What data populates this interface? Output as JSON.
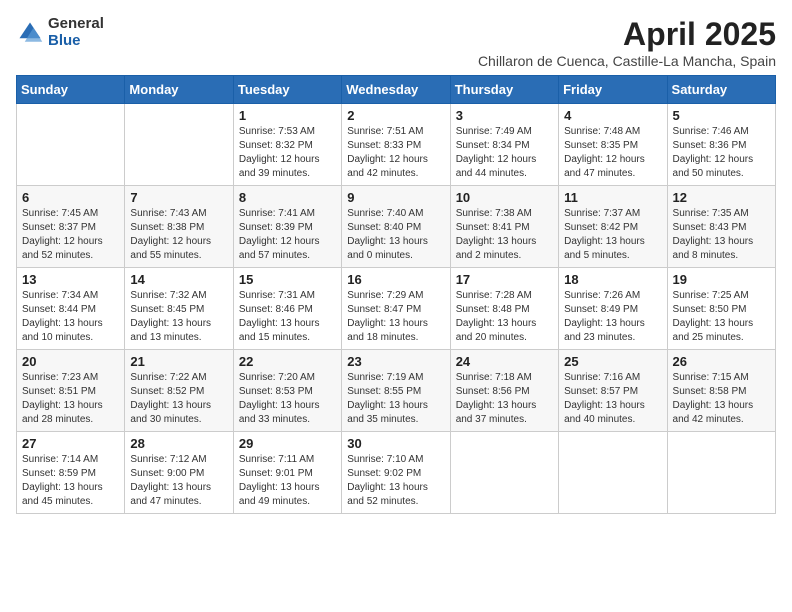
{
  "logo": {
    "general": "General",
    "blue": "Blue"
  },
  "title": "April 2025",
  "location": "Chillaron de Cuenca, Castille-La Mancha, Spain",
  "weekdays": [
    "Sunday",
    "Monday",
    "Tuesday",
    "Wednesday",
    "Thursday",
    "Friday",
    "Saturday"
  ],
  "weeks": [
    [
      null,
      null,
      {
        "day": 1,
        "sunrise": "7:53 AM",
        "sunset": "8:32 PM",
        "daylight": "12 hours and 39 minutes."
      },
      {
        "day": 2,
        "sunrise": "7:51 AM",
        "sunset": "8:33 PM",
        "daylight": "12 hours and 42 minutes."
      },
      {
        "day": 3,
        "sunrise": "7:49 AM",
        "sunset": "8:34 PM",
        "daylight": "12 hours and 44 minutes."
      },
      {
        "day": 4,
        "sunrise": "7:48 AM",
        "sunset": "8:35 PM",
        "daylight": "12 hours and 47 minutes."
      },
      {
        "day": 5,
        "sunrise": "7:46 AM",
        "sunset": "8:36 PM",
        "daylight": "12 hours and 50 minutes."
      }
    ],
    [
      {
        "day": 6,
        "sunrise": "7:45 AM",
        "sunset": "8:37 PM",
        "daylight": "12 hours and 52 minutes."
      },
      {
        "day": 7,
        "sunrise": "7:43 AM",
        "sunset": "8:38 PM",
        "daylight": "12 hours and 55 minutes."
      },
      {
        "day": 8,
        "sunrise": "7:41 AM",
        "sunset": "8:39 PM",
        "daylight": "12 hours and 57 minutes."
      },
      {
        "day": 9,
        "sunrise": "7:40 AM",
        "sunset": "8:40 PM",
        "daylight": "13 hours and 0 minutes."
      },
      {
        "day": 10,
        "sunrise": "7:38 AM",
        "sunset": "8:41 PM",
        "daylight": "13 hours and 2 minutes."
      },
      {
        "day": 11,
        "sunrise": "7:37 AM",
        "sunset": "8:42 PM",
        "daylight": "13 hours and 5 minutes."
      },
      {
        "day": 12,
        "sunrise": "7:35 AM",
        "sunset": "8:43 PM",
        "daylight": "13 hours and 8 minutes."
      }
    ],
    [
      {
        "day": 13,
        "sunrise": "7:34 AM",
        "sunset": "8:44 PM",
        "daylight": "13 hours and 10 minutes."
      },
      {
        "day": 14,
        "sunrise": "7:32 AM",
        "sunset": "8:45 PM",
        "daylight": "13 hours and 13 minutes."
      },
      {
        "day": 15,
        "sunrise": "7:31 AM",
        "sunset": "8:46 PM",
        "daylight": "13 hours and 15 minutes."
      },
      {
        "day": 16,
        "sunrise": "7:29 AM",
        "sunset": "8:47 PM",
        "daylight": "13 hours and 18 minutes."
      },
      {
        "day": 17,
        "sunrise": "7:28 AM",
        "sunset": "8:48 PM",
        "daylight": "13 hours and 20 minutes."
      },
      {
        "day": 18,
        "sunrise": "7:26 AM",
        "sunset": "8:49 PM",
        "daylight": "13 hours and 23 minutes."
      },
      {
        "day": 19,
        "sunrise": "7:25 AM",
        "sunset": "8:50 PM",
        "daylight": "13 hours and 25 minutes."
      }
    ],
    [
      {
        "day": 20,
        "sunrise": "7:23 AM",
        "sunset": "8:51 PM",
        "daylight": "13 hours and 28 minutes."
      },
      {
        "day": 21,
        "sunrise": "7:22 AM",
        "sunset": "8:52 PM",
        "daylight": "13 hours and 30 minutes."
      },
      {
        "day": 22,
        "sunrise": "7:20 AM",
        "sunset": "8:53 PM",
        "daylight": "13 hours and 33 minutes."
      },
      {
        "day": 23,
        "sunrise": "7:19 AM",
        "sunset": "8:55 PM",
        "daylight": "13 hours and 35 minutes."
      },
      {
        "day": 24,
        "sunrise": "7:18 AM",
        "sunset": "8:56 PM",
        "daylight": "13 hours and 37 minutes."
      },
      {
        "day": 25,
        "sunrise": "7:16 AM",
        "sunset": "8:57 PM",
        "daylight": "13 hours and 40 minutes."
      },
      {
        "day": 26,
        "sunrise": "7:15 AM",
        "sunset": "8:58 PM",
        "daylight": "13 hours and 42 minutes."
      }
    ],
    [
      {
        "day": 27,
        "sunrise": "7:14 AM",
        "sunset": "8:59 PM",
        "daylight": "13 hours and 45 minutes."
      },
      {
        "day": 28,
        "sunrise": "7:12 AM",
        "sunset": "9:00 PM",
        "daylight": "13 hours and 47 minutes."
      },
      {
        "day": 29,
        "sunrise": "7:11 AM",
        "sunset": "9:01 PM",
        "daylight": "13 hours and 49 minutes."
      },
      {
        "day": 30,
        "sunrise": "7:10 AM",
        "sunset": "9:02 PM",
        "daylight": "13 hours and 52 minutes."
      },
      null,
      null,
      null
    ]
  ]
}
